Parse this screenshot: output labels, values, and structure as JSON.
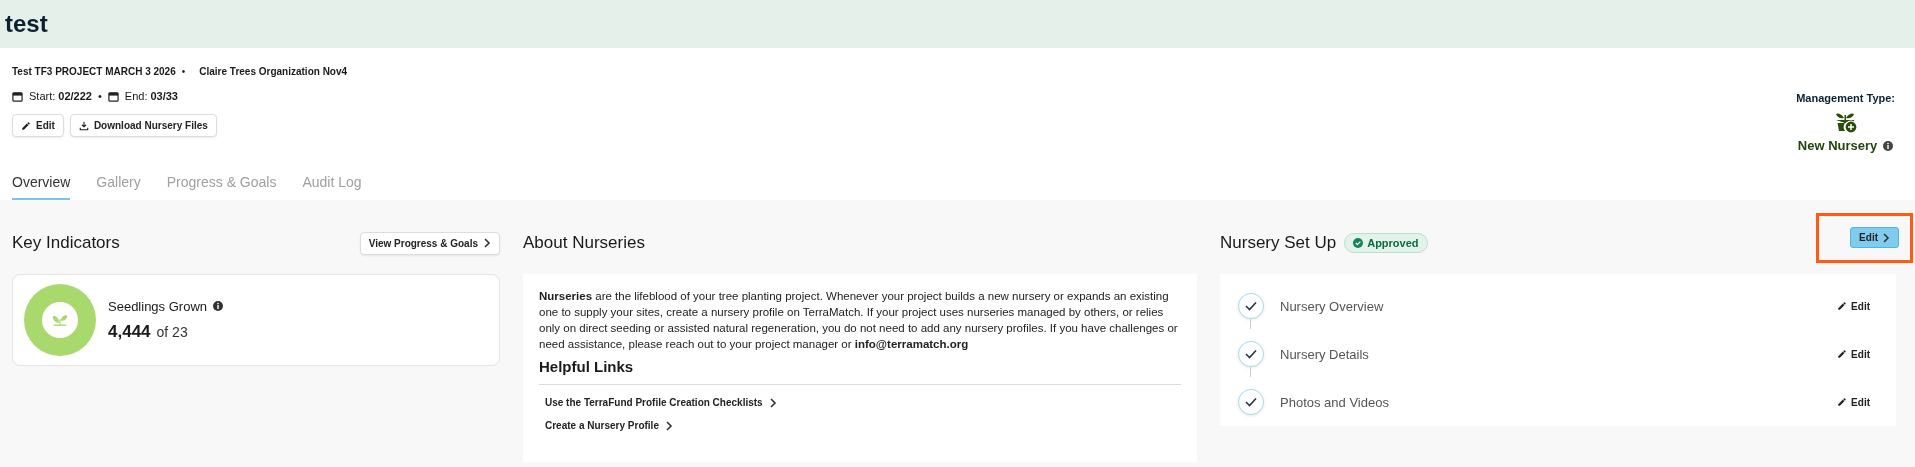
{
  "page_title": "test",
  "project": {
    "name": "Test TF3 PROJECT MARCH 3 2026",
    "separator": "•",
    "organization": "Claire Trees Organization Nov4"
  },
  "dates": {
    "start_label": "Start:",
    "start": "02/222",
    "separator": "•",
    "end_label": "End:",
    "end": "03/33"
  },
  "actions": [
    "Edit",
    "Download Nursery Files"
  ],
  "management": {
    "label": "Management Type:",
    "value": "New Nursery"
  },
  "tabs": [
    {
      "label": "Overview",
      "selected": true
    },
    {
      "label": "Gallery",
      "selected": false
    },
    {
      "label": "Progress & Goals",
      "selected": false
    },
    {
      "label": "Audit Log",
      "selected": false
    }
  ],
  "key_indicators": {
    "title": "Key Indicators",
    "button": "View Progress & Goals",
    "indicator": {
      "label": "Seedlings Grown",
      "value": "4,444",
      "target": "of 23"
    }
  },
  "about": {
    "title": "About Nurseries",
    "text": "**Nurseries** are the lifeblood of your tree planting project. Whenever your project builds a new nursery or expands an existing one to supply your sites, create a nursery profile on TerraMatch. If your project uses nurseries managed by others, or relies only on direct seeding or assisted natural regeneration, you do not need to add any nursery profiles. If you have challenges or need assistance, please reach out to your project manager or **info@terramatch.org**",
    "links_title": "Helpful Links",
    "links": [
      "Use the TerraFund Profile Creation Checklists",
      "Create a Nursery Profile"
    ]
  },
  "setup": {
    "title": "Nursery Set Up",
    "status": "Approved",
    "edit_button": {
      "label": "Edit",
      "highlighted": true
    },
    "steps": [
      {
        "label": "Nursery Overview",
        "completed": true,
        "action": "Edit"
      },
      {
        "label": "Nursery Details",
        "completed": true,
        "action": "Edit"
      },
      {
        "label": "Photos and Videos",
        "completed": true,
        "action": "Edit"
      }
    ]
  }
}
